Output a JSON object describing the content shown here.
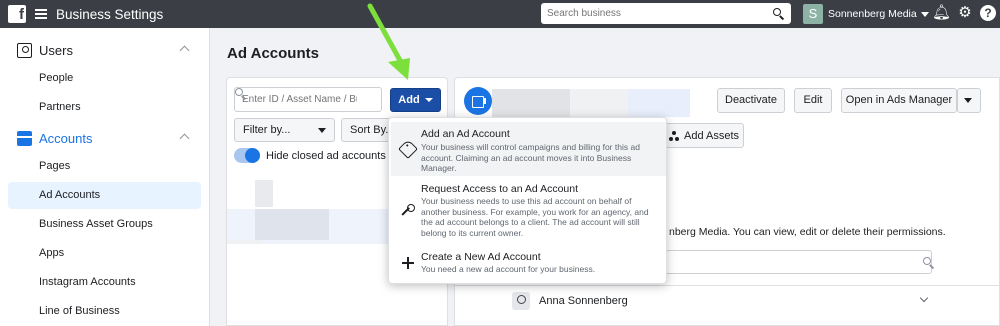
{
  "topbar": {
    "logo": "f",
    "title": "Business Settings",
    "search_placeholder": "Search business",
    "business_initial": "S",
    "business_name": "Sonnenberg Media",
    "help": "?"
  },
  "sidebar": {
    "users_label": "Users",
    "users_items": [
      "People",
      "Partners"
    ],
    "accounts_label": "Accounts",
    "accounts_items": [
      "Pages",
      "Ad Accounts",
      "Business Asset Groups",
      "Apps",
      "Instagram Accounts",
      "Line of Business"
    ],
    "active_item": "Ad Accounts"
  },
  "main": {
    "title": "Ad Accounts",
    "search_placeholder": "Enter ID / Asset Name / Bu...",
    "add_label": "Add",
    "filter_label": "Filter by...",
    "sort_label": "Sort By...",
    "toggle_label": "Hide closed ad accounts",
    "toggle_on": true
  },
  "detail": {
    "deactivate_label": "Deactivate",
    "edit_label": "Edit",
    "open_label": "Open in Ads Manager",
    "add_assets_label": "Add Assets",
    "permission_text": "nberg Media. You can view, edit or delete their permissions.",
    "person_name": "Anna Sonnenberg"
  },
  "dropdown": {
    "items": [
      {
        "title": "Add an Ad Account",
        "desc": "Your business will control campaigns and billing for this ad account. Claiming an ad account moves it into Business Manager.",
        "icon": "tag-icon"
      },
      {
        "title": "Request Access to an Ad Account",
        "desc": "Your business needs to use this ad account on behalf of another business. For example, you work for an agency, and the ad account belongs to a client. The ad account will still belong to its current owner.",
        "icon": "key-icon"
      },
      {
        "title": "Create a New Ad Account",
        "desc": "You need a new ad account for your business.",
        "icon": "plus-icon"
      }
    ]
  },
  "colors": {
    "accent": "#1b74e4",
    "add_button": "#1b4ea7",
    "topbar": "#3b3f45",
    "arrow": "#7ddf3c"
  }
}
